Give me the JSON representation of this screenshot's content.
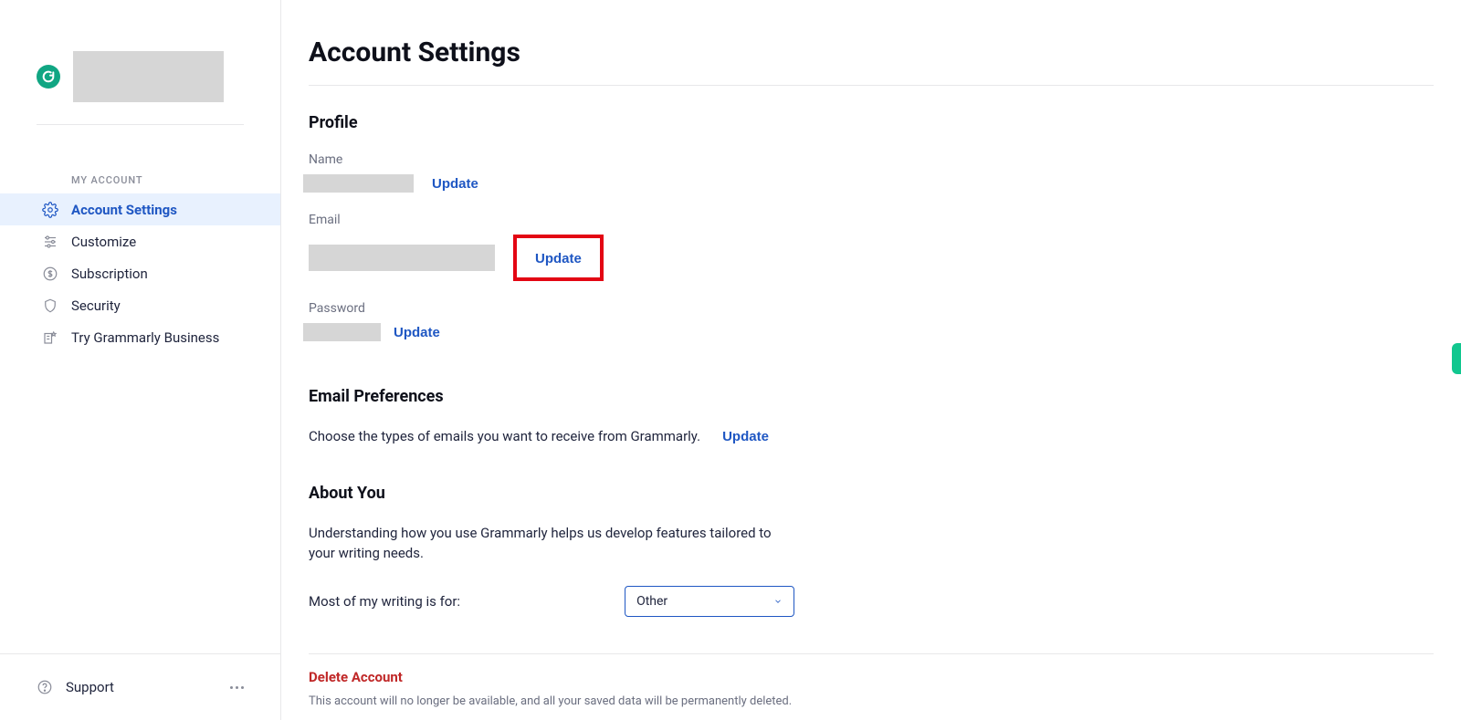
{
  "sidebar": {
    "section_label": "MY ACCOUNT",
    "items": [
      {
        "label": "Account Settings"
      },
      {
        "label": "Customize"
      },
      {
        "label": "Subscription"
      },
      {
        "label": "Security"
      },
      {
        "label": "Try Grammarly Business"
      }
    ],
    "support_label": "Support"
  },
  "page": {
    "title": "Account Settings"
  },
  "profile": {
    "heading": "Profile",
    "name_label": "Name",
    "name_update": "Update",
    "email_label": "Email",
    "email_update": "Update",
    "password_label": "Password",
    "password_update": "Update"
  },
  "email_prefs": {
    "heading": "Email Preferences",
    "desc": "Choose the types of emails you want to receive from Grammarly.",
    "update": "Update"
  },
  "about": {
    "heading": "About You",
    "desc": "Understanding how you use Grammarly helps us develop features tailored to your writing needs.",
    "label": "Most of my writing is for:",
    "selected": "Other"
  },
  "delete": {
    "heading": "Delete Account",
    "desc": "This account will no longer be available, and all your saved data will be permanently deleted."
  }
}
